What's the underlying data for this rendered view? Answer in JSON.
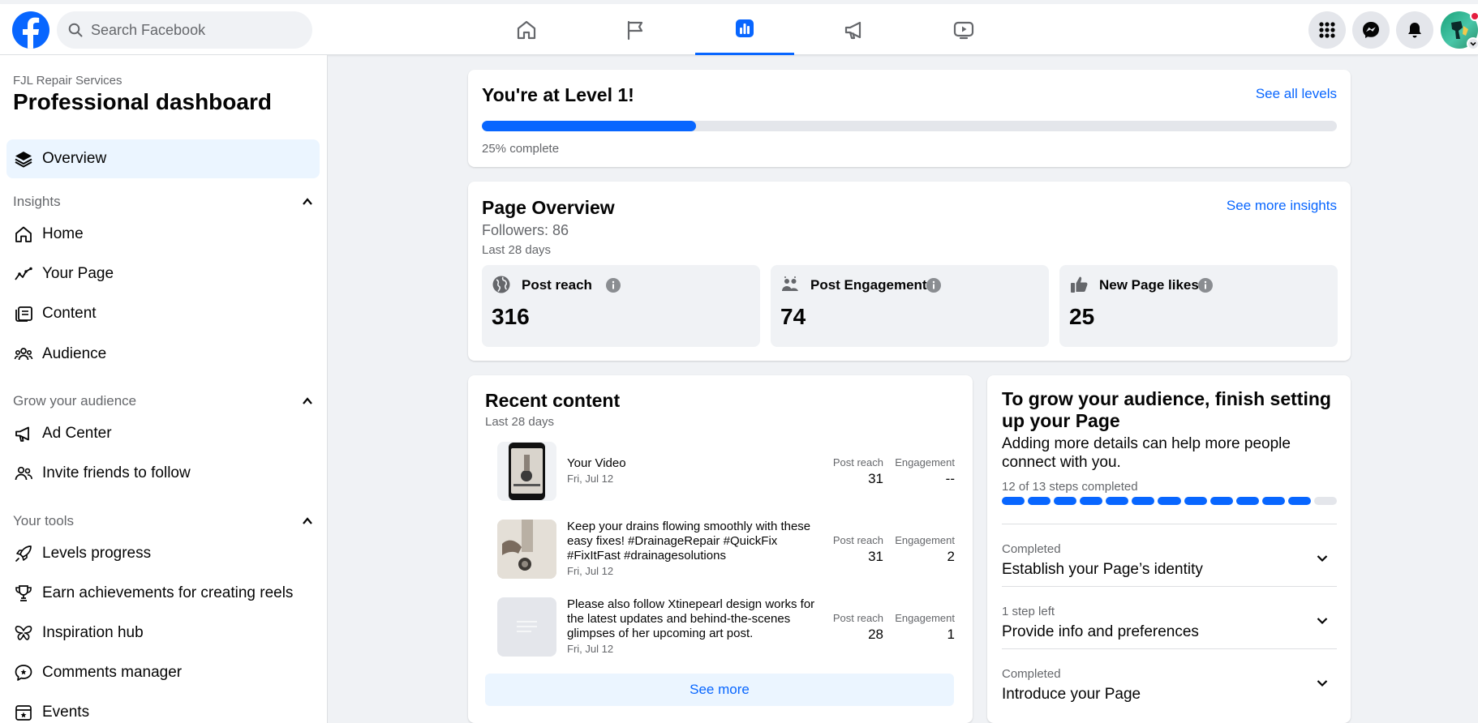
{
  "header": {
    "search_placeholder": "Search Facebook",
    "nav_tabs": [
      {
        "icon": "home-icon",
        "active": false
      },
      {
        "icon": "flag-icon",
        "active": false
      },
      {
        "icon": "insights-chart-icon",
        "active": true
      },
      {
        "icon": "megaphone-icon",
        "active": false
      },
      {
        "icon": "video-icon",
        "active": false
      }
    ],
    "right_icons": [
      "grid-menu-icon",
      "messenger-icon",
      "bell-icon",
      "avatar"
    ],
    "brand_color": "#0866ff"
  },
  "sidebar": {
    "org_name": "FJL Repair Services",
    "title": "Professional dashboard",
    "overview": {
      "label": "Overview",
      "icon": "layers-icon"
    },
    "sections": [
      {
        "title": "Insights",
        "items": [
          {
            "label": "Home",
            "icon": "home-icon"
          },
          {
            "label": "Your Page",
            "icon": "trend-line-icon"
          },
          {
            "label": "Content",
            "icon": "content-icon"
          },
          {
            "label": "Audience",
            "icon": "people-icon"
          }
        ]
      },
      {
        "title": "Grow your audience",
        "items": [
          {
            "label": "Ad Center",
            "icon": "megaphone-icon"
          },
          {
            "label": "Invite friends to follow",
            "icon": "invite-people-icon"
          }
        ]
      },
      {
        "title": "Your tools",
        "items": [
          {
            "label": "Levels progress",
            "icon": "rocket-icon"
          },
          {
            "label": "Earn achievements for creating reels",
            "icon": "trophy-icon"
          },
          {
            "label": "Inspiration hub",
            "icon": "butterfly-icon"
          },
          {
            "label": "Comments manager",
            "icon": "comment-icon"
          },
          {
            "label": "Events",
            "icon": "calendar-icon"
          }
        ]
      }
    ]
  },
  "level": {
    "title": "You're at Level 1!",
    "link": "See all levels",
    "progress_percent": 25,
    "progress_text": "25% complete"
  },
  "overview": {
    "title": "Page Overview",
    "link": "See more insights",
    "followers": "Followers: 86",
    "period": "Last 28 days",
    "metrics": [
      {
        "label": "Post reach",
        "value": "316",
        "icon": "globe-icon"
      },
      {
        "label": "Post Engagement",
        "value": "74",
        "icon": "engagement-people-icon"
      },
      {
        "label": "New Page likes",
        "value": "25",
        "icon": "thumbs-up-icon"
      }
    ]
  },
  "recent": {
    "title": "Recent content",
    "period": "Last 28 days",
    "reach_label": "Post reach",
    "engagement_label": "Engagement",
    "items": [
      {
        "title": "Your Video",
        "date": "Fri, Jul 12",
        "reach": "31",
        "engagement": "--"
      },
      {
        "title": "Keep your drains flowing smoothly with these easy fixes! #DrainageRepair #QuickFix #FixItFast #drainagesolutions",
        "date": "Fri, Jul 12",
        "reach": "31",
        "engagement": "2"
      },
      {
        "title": "Please also follow Xtinepearl design works for the latest updates and behind-the-scenes glimpses of her upcoming art post.",
        "date": "Fri, Jul 12",
        "reach": "28",
        "engagement": "1"
      }
    ],
    "see_more": "See more"
  },
  "grow": {
    "title": "To grow your audience, finish setting up your Page",
    "subtitle": "Adding more details can help more people connect with you.",
    "steps_text": "12 of 13 steps completed",
    "steps_total": 13,
    "steps_completed": 12,
    "items": [
      {
        "status": "Completed",
        "name": "Establish your Page’s identity"
      },
      {
        "status": "1 step left",
        "name": "Provide info and preferences"
      },
      {
        "status": "Completed",
        "name": "Introduce your Page"
      }
    ]
  }
}
